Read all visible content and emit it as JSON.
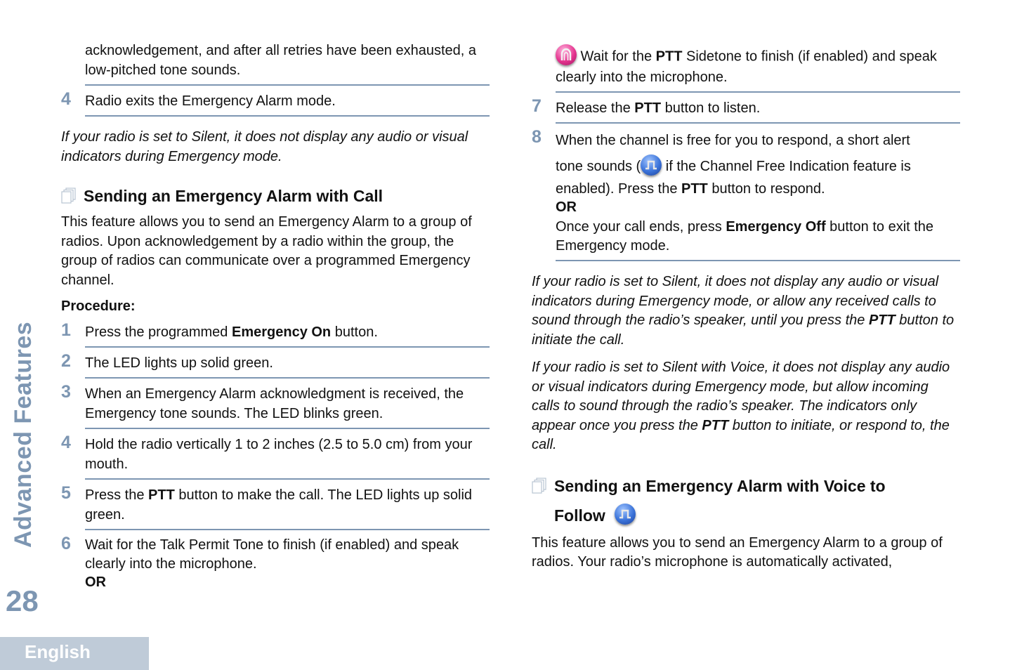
{
  "sidebar": {
    "section_title": "Advanced Features",
    "page_number": "28",
    "language": "English"
  },
  "left_column": {
    "continued_step": {
      "text": "acknowledgement, and after all retries have been exhausted, a low-pitched tone sounds."
    },
    "prev_step_4": {
      "num": "4",
      "text": "Radio exits the Emergency Alarm mode."
    },
    "silent_note": "If your radio is set to Silent, it does not display any audio or visual indicators during Emergency mode.",
    "section": {
      "title": "Sending an Emergency Alarm with Call",
      "intro": "This feature allows you to send an Emergency Alarm to a group of radios. Upon acknowledgement by a radio within the group, the group of radios can communicate over a programmed Emergency channel.",
      "procedure_label": "Procedure:",
      "steps": [
        {
          "num": "1",
          "pre": "Press the programmed ",
          "bold": "Emergency On",
          "post": " button."
        },
        {
          "num": "2",
          "text": "The LED lights up solid green."
        },
        {
          "num": "3",
          "text": "When an Emergency Alarm acknowledgment is received, the Emergency tone sounds. The LED blinks green."
        },
        {
          "num": "4",
          "text": "Hold the radio vertically 1 to 2 inches (2.5 to 5.0 cm) from your mouth."
        },
        {
          "num": "5",
          "pre": "Press the ",
          "bold": "PTT",
          "post": " button to make the call. The LED lights up solid green."
        },
        {
          "num": "6",
          "text": "Wait for the Talk Permit Tone to finish (if enabled) and speak clearly into the microphone.",
          "or": "OR"
        }
      ]
    }
  },
  "right_column": {
    "step6_cont": {
      "icon": "ptt-sidetone-icon",
      "pre": " Wait for the ",
      "bold": "PTT",
      "post": " Sidetone to finish (if enabled) and speak clearly into the microphone."
    },
    "steps": [
      {
        "num": "7",
        "pre": "Release the ",
        "bold": "PTT",
        "post": " button to listen."
      },
      {
        "num": "8",
        "line1": "When the channel is free for you to respond, a short alert",
        "line2_pre": "tone sounds (",
        "icon": "channel-free-tone-icon",
        "line2_post": " if the Channel Free Indication feature is",
        "line3_pre": "enabled). Press the ",
        "line3_bold": "PTT",
        "line3_post": " button to respond.",
        "or": "OR",
        "alt_pre": "Once your call ends, press ",
        "alt_bold": "Emergency Off",
        "alt_post": " button to exit the Emergency mode."
      }
    ],
    "note1": {
      "pre": "If your radio is set to Silent, it does not display any audio or visual indicators during Emergency mode, or allow any received calls to sound through the radio’s speaker, until you press the ",
      "bold": "PTT",
      "post": " button to initiate the call."
    },
    "note2": {
      "pre": "If your radio is set to Silent with Voice, it does not display any audio or visual indicators during Emergency mode, but allow incoming calls to sound through the radio’s speaker. The indicators only appear once you press the ",
      "bold": "PTT",
      "post": " button to initiate, or respond to, the call."
    },
    "section": {
      "title_line1": "Sending an Emergency Alarm with Voice to",
      "title_line2": "Follow",
      "intro": "This feature allows you to send an Emergency Alarm to a group of radios. Your radio’s microphone is automatically activated,"
    }
  }
}
